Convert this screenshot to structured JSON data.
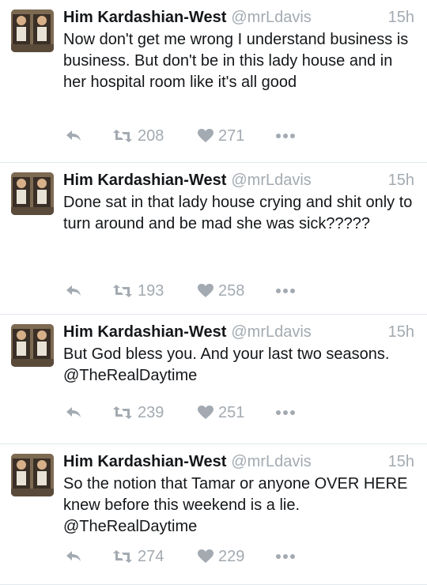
{
  "tweets": [
    {
      "name": "Him Kardashian-West",
      "handle": "@mrLdavis",
      "time": "15h",
      "text": "Now don't get me wrong I understand business is business. But don't be in this lady house and in her hospital room like it's all good",
      "retweets": "208",
      "likes": "271"
    },
    {
      "name": "Him Kardashian-West",
      "handle": "@mrLdavis",
      "time": "15h",
      "text": "Done sat in that lady house crying and shit only to turn around and be mad she was sick?????",
      "retweets": "193",
      "likes": "258"
    },
    {
      "name": "Him Kardashian-West",
      "handle": "@mrLdavis",
      "time": "15h",
      "text": "But God bless you. And your last two seasons. @TheRealDaytime",
      "retweets": "239",
      "likes": "251"
    },
    {
      "name": "Him Kardashian-West",
      "handle": "@mrLdavis",
      "time": "15h",
      "text": "So the notion that Tamar or anyone OVER HERE knew before this weekend is a lie. @TheRealDaytime",
      "retweets": "274",
      "likes": "229"
    }
  ],
  "icons": {
    "reply": "reply-icon",
    "retweet": "retweet-icon",
    "like": "heart-icon",
    "more": "more-dots-icon"
  },
  "colors": {
    "text": "#14171a",
    "secondary": "#a3aab1",
    "divider": "#e1e8ed"
  }
}
